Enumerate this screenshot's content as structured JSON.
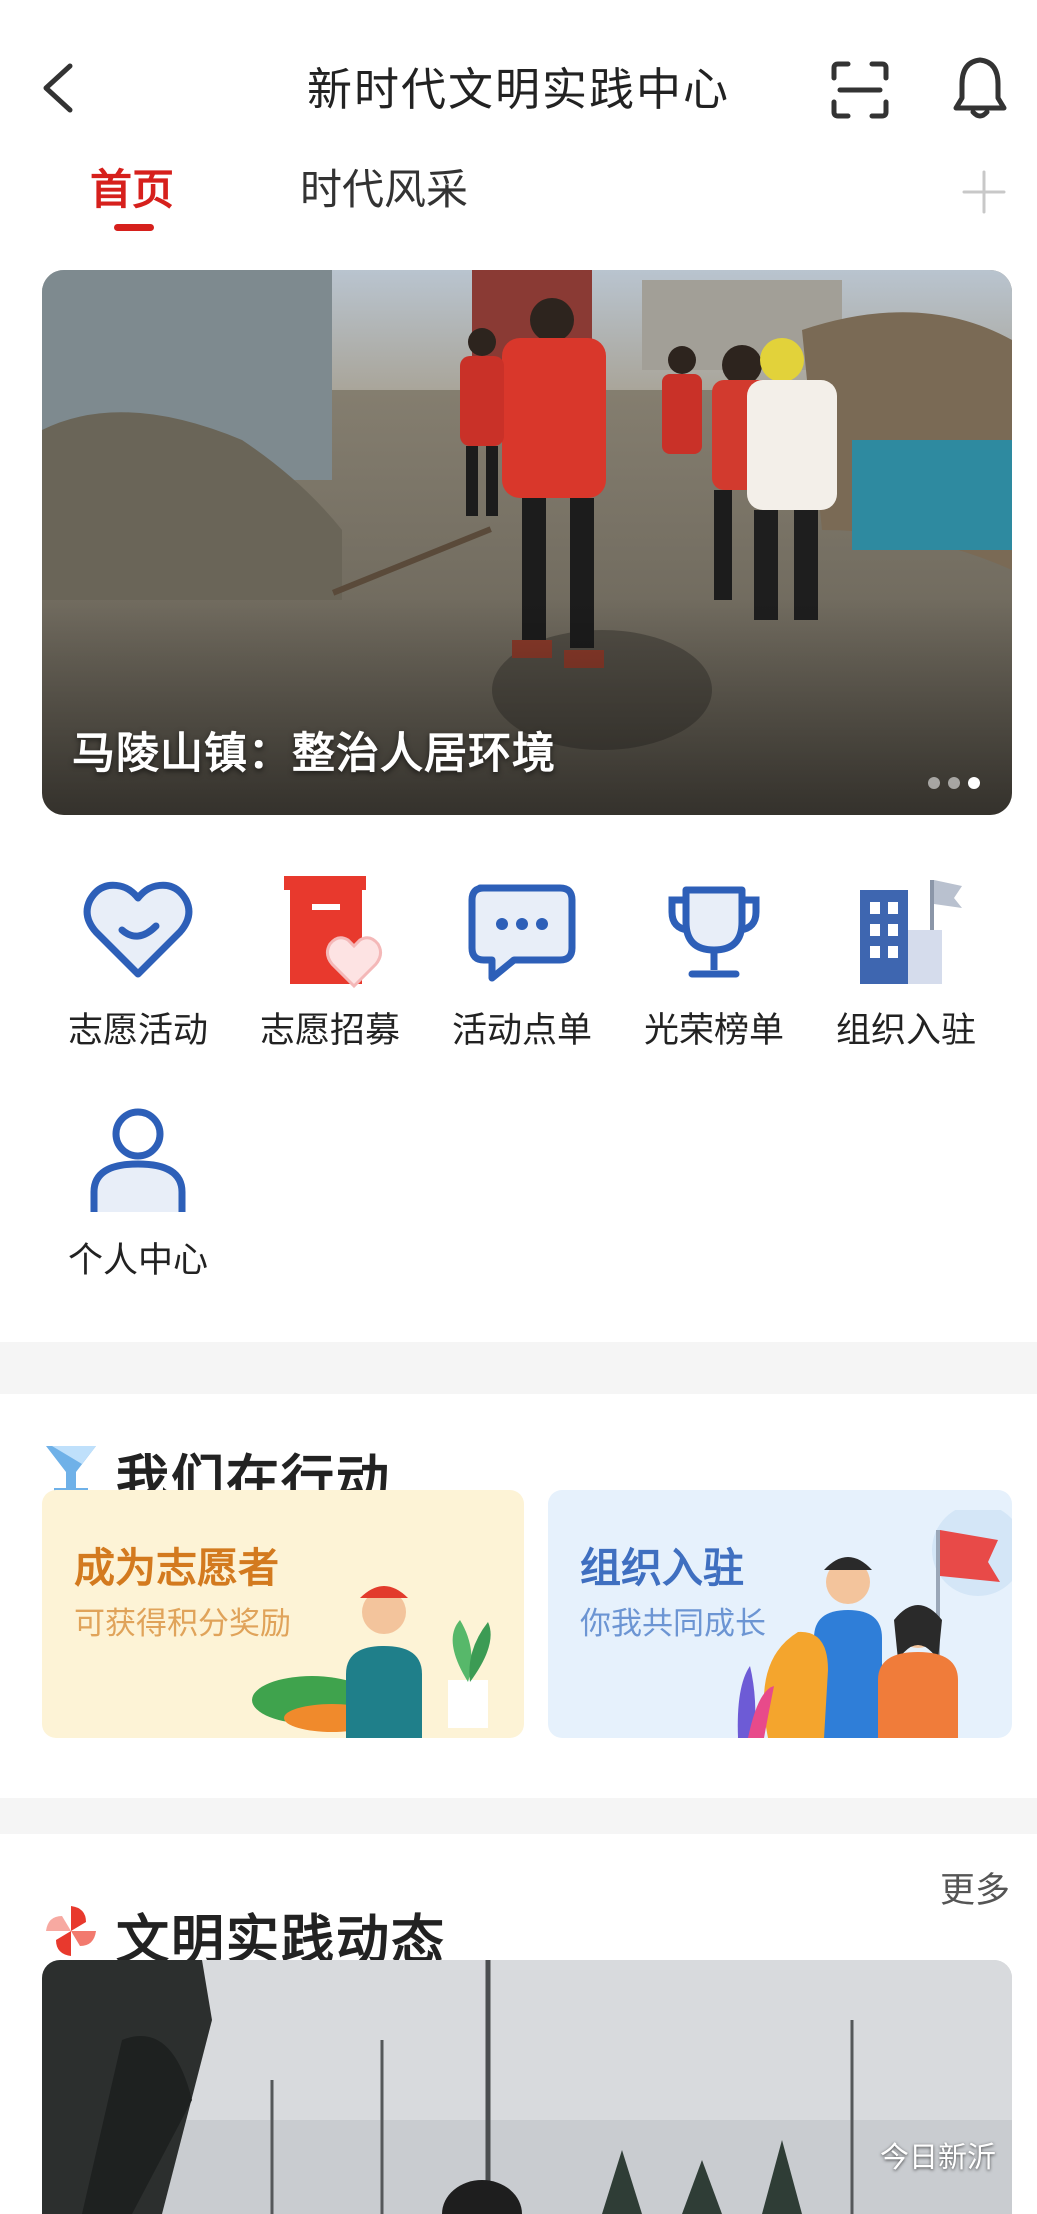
{
  "header": {
    "title": "新时代文明实践中心"
  },
  "tabs": [
    {
      "label": "首页"
    },
    {
      "label": "时代风采"
    }
  ],
  "banner": {
    "caption": "马陵山镇：整治人居环境"
  },
  "quick_menu": [
    {
      "label": "志愿活动",
      "icon": "heart-smile-icon"
    },
    {
      "label": "志愿招募",
      "icon": "recruit-heart-icon"
    },
    {
      "label": "活动点单",
      "icon": "chat-bubble-icon"
    },
    {
      "label": "光荣榜单",
      "icon": "trophy-icon"
    },
    {
      "label": "组织入驻",
      "icon": "building-flag-icon"
    },
    {
      "label": "个人中心",
      "icon": "person-icon"
    }
  ],
  "actions": {
    "title": "我们在行动",
    "cards": [
      {
        "title": "成为志愿者",
        "subtitle": "可获得积分奖励"
      },
      {
        "title": "组织入驻",
        "subtitle": "你我共同成长"
      }
    ]
  },
  "news": {
    "title": "文明实践动态",
    "more_label": "更多"
  },
  "watermark": "今日新沂",
  "colors": {
    "accent": "#d6201c",
    "icon_blue": "#2d5fb8",
    "card_yellow": "#fdf3d6",
    "card_blue": "#e6f1fc"
  }
}
